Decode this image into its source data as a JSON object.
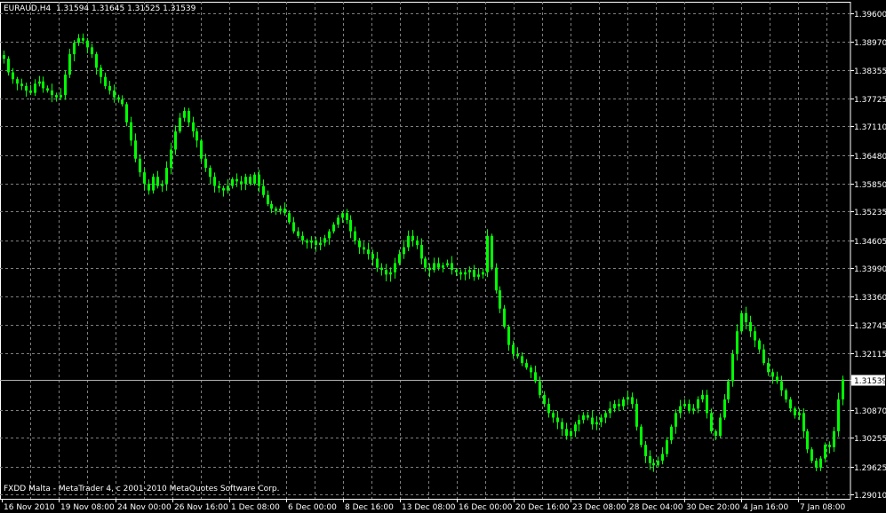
{
  "header": {
    "symbol": "EURAUD,H4",
    "ohlc": "1.31594 1.31645 1.31525 1.31539"
  },
  "footer": {
    "copyright": "FXDD Malta - MetaTrader 4, c 2001-2010 MetaQuotes Software Corp."
  },
  "colors": {
    "background": "#000000",
    "candle": "#00ff00",
    "grid": "#7f7f7f",
    "text": "#ffffff",
    "bid_line": "#b0b0b0"
  },
  "chart_data": {
    "type": "line",
    "ylim": [
      1.2901,
      1.396
    ],
    "y_ticks": [
      "1.39600",
      "1.38970",
      "1.38355",
      "1.37725",
      "1.37110",
      "1.36480",
      "1.35850",
      "1.35235",
      "1.34605",
      "1.33990",
      "1.33360",
      "1.32745",
      "1.32115",
      "1.31539",
      "1.30870",
      "1.30255",
      "1.29625",
      "1.29010"
    ],
    "x_ticks": [
      "16 Nov 2010",
      "19 Nov 08:00",
      "24 Nov 00:00",
      "26 Nov 16:00",
      "1 Dec 08:00",
      "6 Dec 00:00",
      "8 Dec 16:00",
      "13 Dec 08:00",
      "16 Dec 00:00",
      "20 Dec 16:00",
      "23 Dec 08:00",
      "28 Dec 04:00",
      "30 Dec 20:00",
      "4 Jan 16:00",
      "7 Jan 08:00"
    ],
    "current_price": "1.31539",
    "series": [
      {
        "values": [
          1.386,
          1.383,
          1.3815,
          1.3805,
          1.38,
          1.379,
          1.3785,
          1.3805,
          1.381,
          1.3795,
          1.379,
          1.378,
          1.3775,
          1.378,
          1.3825,
          1.387,
          1.3895,
          1.3905,
          1.39,
          1.3885,
          1.387,
          1.384,
          1.382,
          1.38,
          1.379,
          1.3775,
          1.377,
          1.376,
          1.372,
          1.368,
          1.364,
          1.361,
          1.3585,
          1.357,
          1.36,
          1.358,
          1.3585,
          1.362,
          1.366,
          1.37,
          1.373,
          1.3745,
          1.372,
          1.37,
          1.368,
          1.364,
          1.362,
          1.36,
          1.358,
          1.3575,
          1.357,
          1.358,
          1.3595,
          1.359,
          1.3585,
          1.36,
          1.3585,
          1.3605,
          1.358,
          1.356,
          1.354,
          1.353,
          1.3525,
          1.353,
          1.352,
          1.35,
          1.348,
          1.347,
          1.346,
          1.3455,
          1.346,
          1.345,
          1.3455,
          1.3465,
          1.348,
          1.3495,
          1.351,
          1.352,
          1.3505,
          1.348,
          1.346,
          1.3445,
          1.344,
          1.343,
          1.342,
          1.34,
          1.3395,
          1.3385,
          1.339,
          1.341,
          1.343,
          1.3445,
          1.347,
          1.346,
          1.345,
          1.342,
          1.34,
          1.3395,
          1.341,
          1.34,
          1.3405,
          1.341,
          1.3395,
          1.339,
          1.3385,
          1.339,
          1.3395,
          1.338,
          1.3385,
          1.339,
          1.347,
          1.34,
          1.335,
          1.331,
          1.327,
          1.323,
          1.321,
          1.3205,
          1.319,
          1.318,
          1.317,
          1.315,
          1.312,
          1.31,
          1.308,
          1.307,
          1.306,
          1.3045,
          1.303,
          1.304,
          1.3055,
          1.3065,
          1.3075,
          1.307,
          1.3055,
          1.306,
          1.307,
          1.308,
          1.309,
          1.31,
          1.3095,
          1.311,
          1.3115,
          1.31,
          1.305,
          1.301,
          1.2985,
          1.297,
          1.2965,
          1.2975,
          1.299,
          1.302,
          1.305,
          1.308,
          1.3095,
          1.31,
          1.3085,
          1.309,
          1.311,
          1.312,
          1.308,
          1.304,
          1.303,
          1.307,
          1.311,
          1.315,
          1.321,
          1.326,
          1.33,
          1.328,
          1.326,
          1.324,
          1.322,
          1.319,
          1.317,
          1.316,
          1.315,
          1.313,
          1.311,
          1.309,
          1.3075,
          1.308,
          1.304,
          1.3,
          1.2975,
          1.296,
          1.298,
          1.301,
          1.3005,
          1.304,
          1.311,
          1.3154
        ]
      }
    ]
  }
}
